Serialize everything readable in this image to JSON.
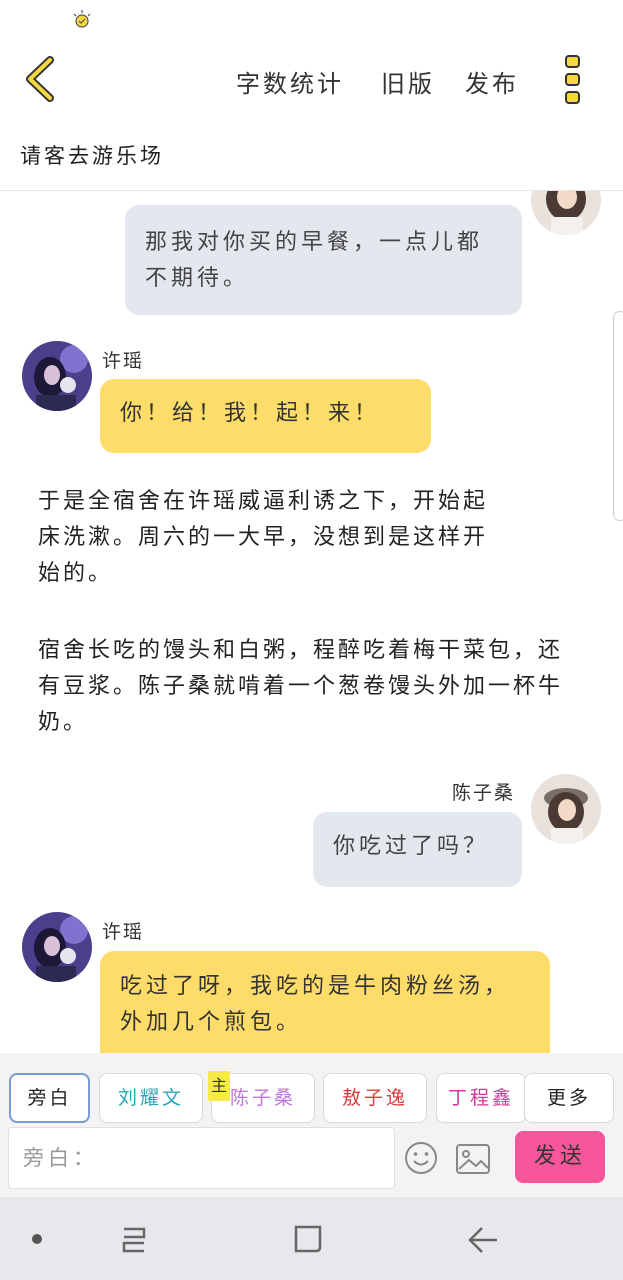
{
  "header": {
    "actions": [
      "字数统计",
      "旧版",
      "发布"
    ],
    "title": "请客去游乐场"
  },
  "messages": [
    {
      "type": "bubble",
      "side": "right",
      "speaker": "",
      "text": "那我对你买的早餐，一点儿都不期待。"
    },
    {
      "type": "bubble",
      "side": "left",
      "speaker": "许瑶",
      "text": "你！给！我！起！来！"
    },
    {
      "type": "narration",
      "text": "于是全宿舍在许瑶威逼利诱之下，开始起床洗漱。周六的一大早，没想到是这样开始的。"
    },
    {
      "type": "narration",
      "text": "宿舍长吃的馒头和白粥，程醉吃着梅干菜包，还有豆浆。陈子桑就啃着一个葱卷馒头外加一杯牛奶。"
    },
    {
      "type": "bubble",
      "side": "right",
      "speaker": "陈子桑",
      "text": "你吃过了吗？"
    },
    {
      "type": "bubble",
      "side": "left",
      "speaker": "许瑶",
      "text": "吃过了呀，我吃的是牛肉粉丝汤，外加几个煎包。"
    }
  ],
  "characters": [
    {
      "label": "旁白",
      "color": "#444444",
      "active": true
    },
    {
      "label": "刘耀文",
      "color": "#2aa6b8"
    },
    {
      "label": "陈子桑",
      "color": "#c078d8"
    },
    {
      "label": "敖子逸",
      "color": "#d83c3c"
    },
    {
      "label": "丁程鑫",
      "color": "#d4399a"
    },
    {
      "label": "更多",
      "color": "#444444"
    }
  ],
  "host_tag": "主",
  "composer": {
    "placeholder": "旁白：",
    "send_label": "发送"
  },
  "colors": {
    "accent_yellow": "#f5d742",
    "bubble_left": "#fddc6a",
    "bubble_right": "#e3e7ee",
    "send_button": "#f7579a"
  },
  "icons": {
    "back": "chevron-left-icon",
    "menu": "more-vertical-icon",
    "emoji": "smiley-icon",
    "image": "image-icon",
    "nav": [
      "dot-icon",
      "recent-apps-icon",
      "home-icon",
      "back-arrow-icon"
    ]
  }
}
